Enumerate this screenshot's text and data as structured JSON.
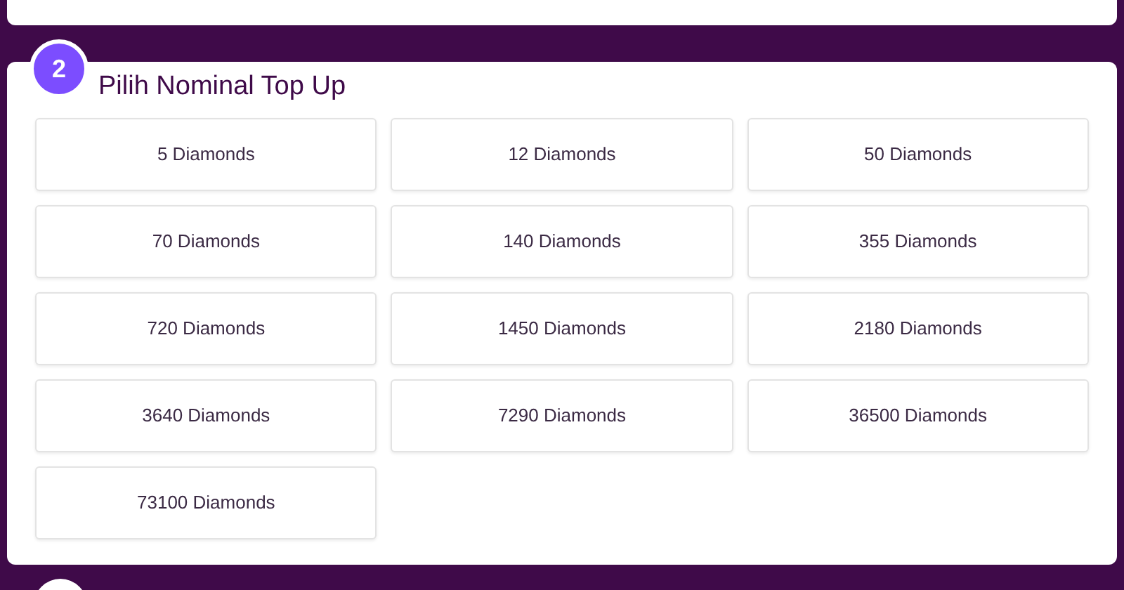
{
  "section": {
    "step": "2",
    "title": "Pilih Nominal Top Up"
  },
  "options": [
    {
      "label": "5 Diamonds"
    },
    {
      "label": "12 Diamonds"
    },
    {
      "label": "50 Diamonds"
    },
    {
      "label": "70 Diamonds"
    },
    {
      "label": "140 Diamonds"
    },
    {
      "label": "355 Diamonds"
    },
    {
      "label": "720 Diamonds"
    },
    {
      "label": "1450 Diamonds"
    },
    {
      "label": "2180 Diamonds"
    },
    {
      "label": "3640 Diamonds"
    },
    {
      "label": "7290 Diamonds"
    },
    {
      "label": "36500 Diamonds"
    },
    {
      "label": "73100 Diamonds"
    }
  ]
}
